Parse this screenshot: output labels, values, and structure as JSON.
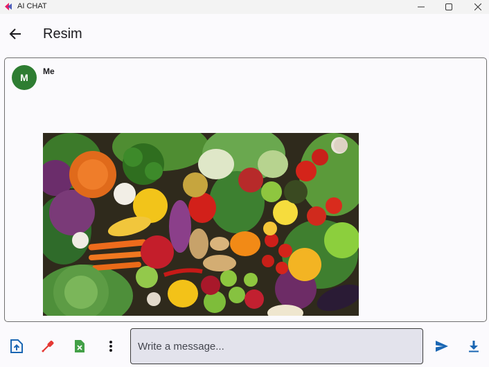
{
  "window": {
    "title": "AI CHAT",
    "logo_colors": [
      "#e91e63",
      "#3f51b5"
    ]
  },
  "header": {
    "title": "Resim",
    "back_icon": "arrow-left-icon"
  },
  "message": {
    "sender": "Me",
    "avatar_letter": "M",
    "avatar_color": "#2e7d32",
    "image_subject": "assorted-vegetables-image"
  },
  "toolbar": {
    "upload_icon": "file-upload-icon",
    "picker_icon": "eyedropper-icon",
    "delete_icon": "delete-file-icon",
    "more_icon": "more-vertical-icon",
    "send_icon": "send-icon",
    "download_icon": "download-icon",
    "accent_color": "#1a66b3"
  },
  "composer": {
    "placeholder": "Write a message..."
  }
}
